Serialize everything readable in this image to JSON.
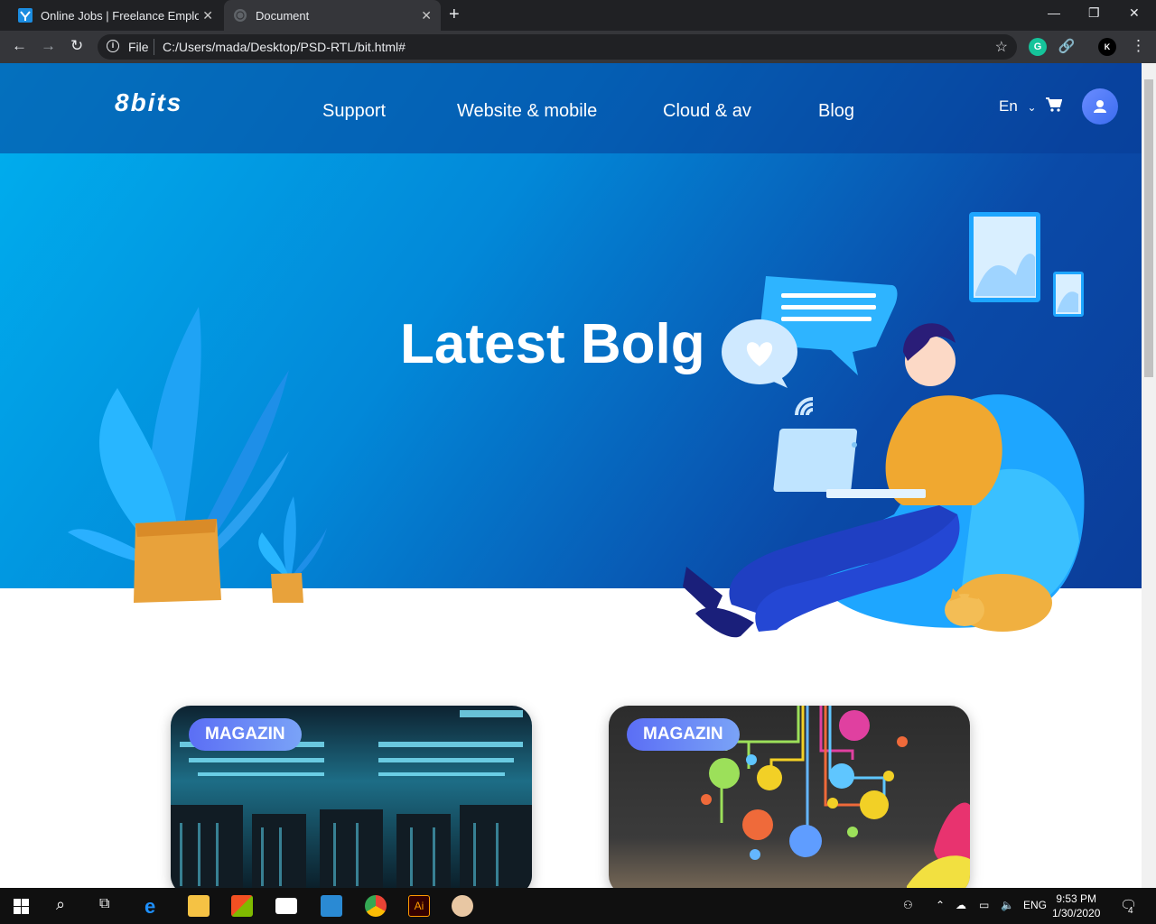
{
  "browser": {
    "tabs": [
      {
        "title": "Online Jobs | Freelance Employm",
        "active": false
      },
      {
        "title": "Document",
        "active": true
      }
    ],
    "file_label": "File",
    "url": "C:/Users/mada/Desktop/PSD-RTL/bit.html#"
  },
  "site": {
    "logo": "8bits",
    "nav": [
      "Support",
      "Website & mobile",
      "Cloud & av",
      "Blog"
    ],
    "language": "En",
    "hero_title": "Latest Bolg",
    "cards": [
      {
        "badge": "MAGAZIN"
      },
      {
        "badge": "MAGAZIN"
      }
    ]
  },
  "taskbar": {
    "language": "ENG",
    "time": "9:53 PM",
    "date": "1/30/2020",
    "notifications": "4"
  },
  "colors": {
    "hero_gradient_start": "#00b0ef",
    "hero_gradient_end": "#0b3d9a",
    "badge_gradient": "#5b6ef5"
  }
}
